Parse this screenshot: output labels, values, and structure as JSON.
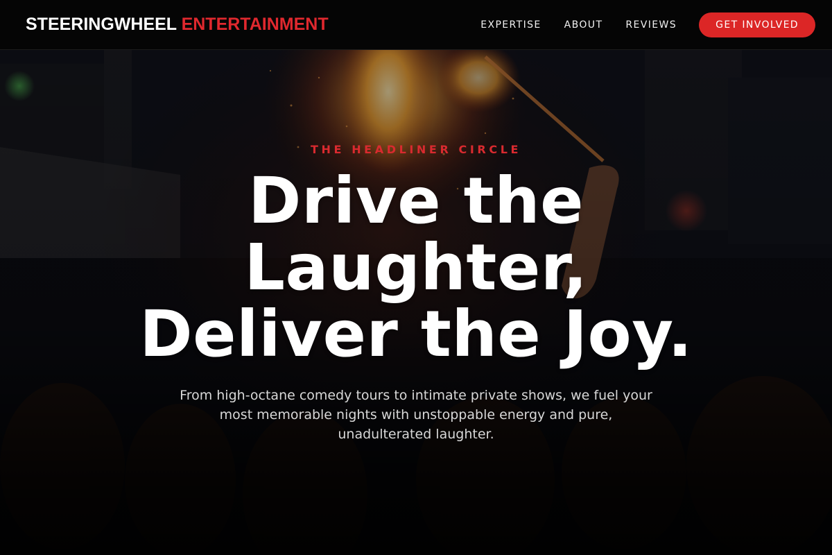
{
  "header": {
    "logo_part1": "STEERINGWHEEL",
    "logo_part2": "ENTERTAINMENT",
    "nav": [
      {
        "label": "EXPERTISE"
      },
      {
        "label": "ABOUT"
      },
      {
        "label": "REVIEWS"
      }
    ],
    "cta_label": "GET INVOLVED"
  },
  "hero": {
    "eyebrow": "THE HEADLINER CIRCLE",
    "headline_line1": "Drive the",
    "headline_line2": "Laughter,",
    "headline_line3": "Deliver the Joy.",
    "subtext": "From high-octane comedy tours to intimate private shows, we fuel your most memorable nights with unstoppable energy and pure, unadulterated laughter.",
    "background_image": "fire-performer-crowd"
  },
  "colors": {
    "accent": "#dc2626",
    "header_bg": "#050505",
    "text": "#ffffff"
  }
}
